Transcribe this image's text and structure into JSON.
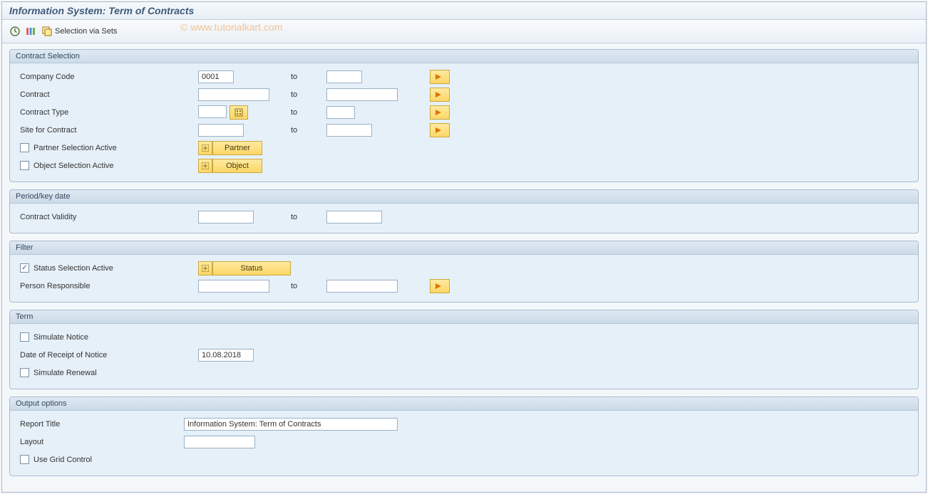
{
  "header": {
    "title": "Information System: Term of Contracts"
  },
  "toolbar": {
    "selection_via_sets": "Selection via Sets",
    "watermark": "© www.tutorialkart.com"
  },
  "groups": {
    "contract_selection": {
      "title": "Contract Selection",
      "company_code": {
        "label": "Company Code",
        "from": "0001",
        "to": ""
      },
      "contract": {
        "label": "Contract",
        "from": "",
        "to": ""
      },
      "contract_type": {
        "label": "Contract Type",
        "from": "",
        "to": ""
      },
      "site": {
        "label": "Site for Contract",
        "from": "",
        "to": ""
      },
      "partner_active": {
        "label": "Partner Selection Active",
        "checked": false,
        "button": "Partner"
      },
      "object_active": {
        "label": "Object Selection Active",
        "checked": false,
        "button": "Object"
      },
      "to_label": "to"
    },
    "period": {
      "title": "Period/key date",
      "contract_validity": {
        "label": "Contract Validity",
        "from": "",
        "to": ""
      },
      "to_label": "to"
    },
    "filter": {
      "title": "Filter",
      "status_active": {
        "label": "Status Selection Active",
        "checked": true,
        "button": "Status"
      },
      "person_resp": {
        "label": "Person Responsible",
        "from": "",
        "to": ""
      },
      "to_label": "to"
    },
    "term": {
      "title": "Term",
      "simulate_notice": {
        "label": "Simulate Notice",
        "checked": false
      },
      "date_receipt": {
        "label": "Date of Receipt of Notice",
        "value": "10.08.2018"
      },
      "simulate_renewal": {
        "label": "Simulate Renewal",
        "checked": false
      }
    },
    "output": {
      "title": "Output options",
      "report_title": {
        "label": "Report Title",
        "value": "Information System: Term of Contracts"
      },
      "layout": {
        "label": "Layout",
        "value": ""
      },
      "use_grid": {
        "label": "Use Grid Control",
        "checked": false
      }
    }
  }
}
